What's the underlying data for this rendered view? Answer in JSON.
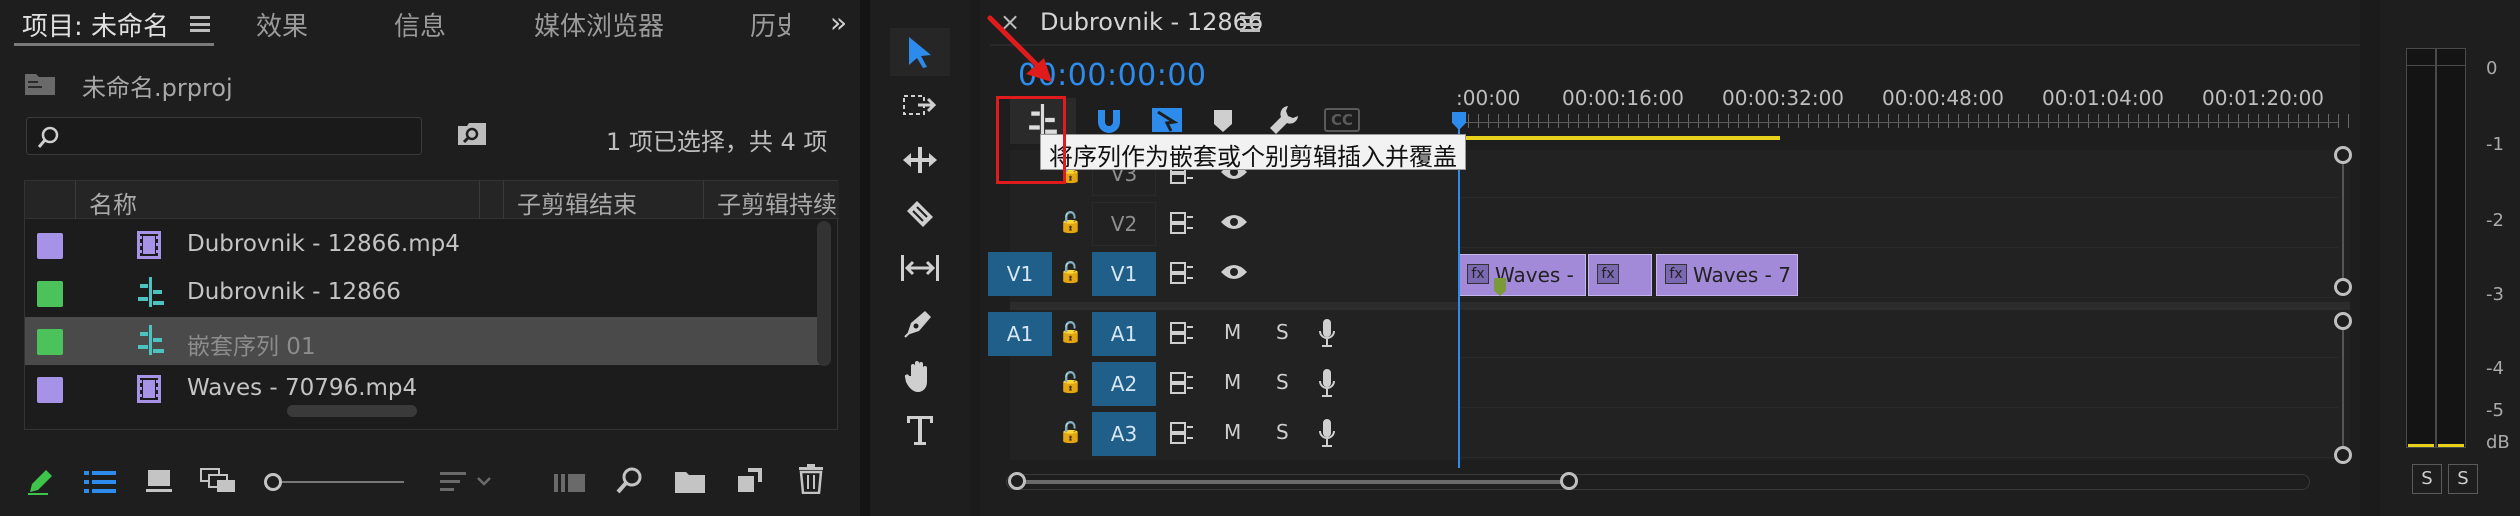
{
  "project_panel": {
    "tabs": [
      "项目: 未命名",
      "效果",
      "信息",
      "媒体浏览器",
      "历史"
    ],
    "overflow": "»",
    "file_name": "未命名.prproj",
    "search_placeholder": "",
    "selection_info": "1 项已选择，共 4 项",
    "columns": [
      "名称",
      "子剪辑结束",
      "子剪辑持续"
    ],
    "items": [
      {
        "name": "Dubrovnik - 12866.mp4",
        "color": "#a692e6",
        "type": "video",
        "selected": false
      },
      {
        "name": "Dubrovnik - 12866",
        "color": "#4cc35a",
        "type": "sequence",
        "selected": false
      },
      {
        "name": "嵌套序列 01",
        "color": "#4cc35a",
        "type": "sequence",
        "selected": true
      },
      {
        "name": "Waves - 70796.mp4",
        "color": "#a692e6",
        "type": "video",
        "selected": false
      }
    ]
  },
  "timeline": {
    "close": "×",
    "sequence_name": "Dubrovnik - 12866",
    "timecode": "00:00:00:00",
    "ruler": [
      ":00:00",
      "00:00:16:00",
      "00:00:32:00",
      "00:00:48:00",
      "00:01:04:00",
      "00:01:20:00"
    ],
    "tooltip": "将序列作为嵌套或个别剪辑插入并覆盖",
    "video_tracks": [
      "V3",
      "V2",
      "V1"
    ],
    "audio_tracks": [
      "A1",
      "A2",
      "A3"
    ],
    "source_patch_v": "V1",
    "source_patch_a": "A1",
    "mute_label": "M",
    "solo_label": "S",
    "clips": [
      {
        "label": "Waves -",
        "fx": "fx"
      },
      {
        "label": "",
        "fx": "fx"
      },
      {
        "label": "Waves - 7",
        "fx": "fx"
      }
    ],
    "cc": "CC"
  },
  "meter": {
    "scale": [
      "0",
      "-1",
      "-2",
      "-3",
      "-4",
      "-5",
      "dB"
    ],
    "solo_buttons": [
      "S",
      "S"
    ]
  },
  "colors": {
    "accent_blue": "#2d8ceb",
    "track_blue": "#1f5f8a",
    "clip_violet": "#a28ad8",
    "highlight_red": "#e01b1b",
    "work_area_yellow": "#e6d21a"
  }
}
